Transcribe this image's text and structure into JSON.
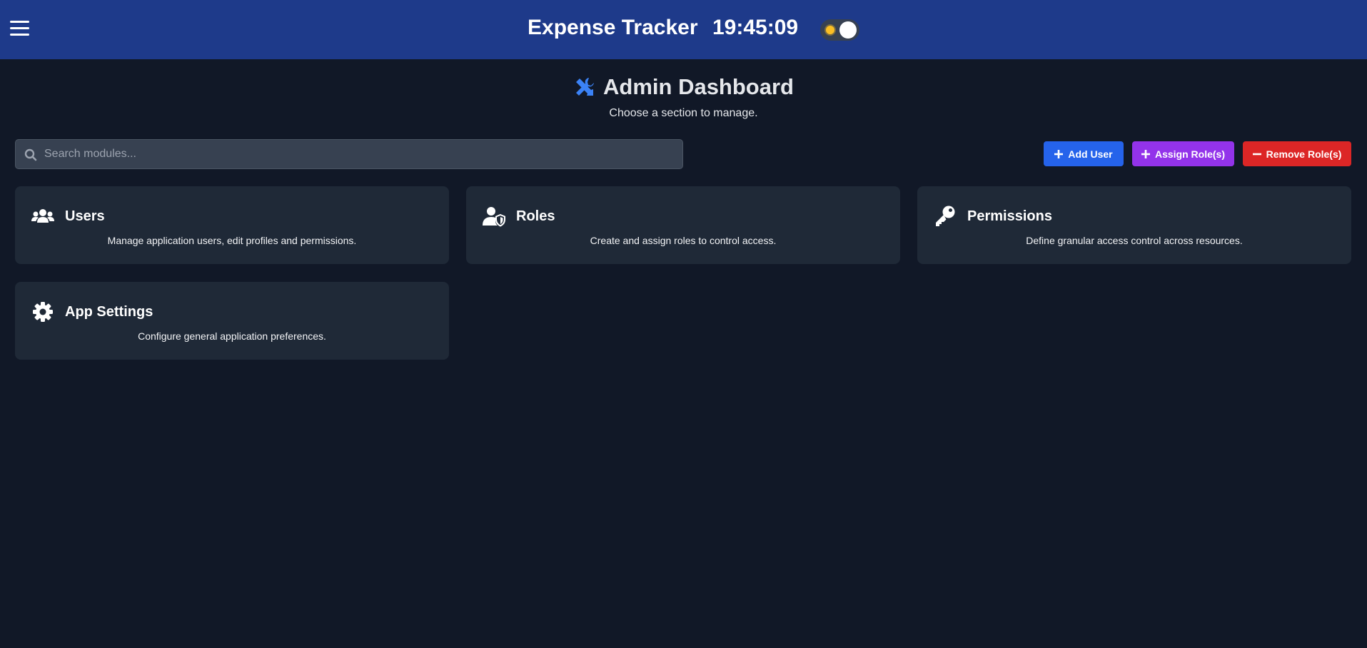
{
  "header": {
    "menu_icon": "hamburger-menu-icon",
    "app_title": "Expense Tracker",
    "clock": "19:45:09",
    "theme_toggle": {
      "icon": "sun-icon",
      "mode": "dark"
    }
  },
  "page": {
    "icon": "tools-icon",
    "title": "Admin Dashboard",
    "subtitle": "Choose a section to manage."
  },
  "search": {
    "icon": "search-icon",
    "placeholder": "Search modules...",
    "value": ""
  },
  "actions": {
    "add_user": {
      "icon": "plus-icon",
      "label": "Add User",
      "color": "#2563eb"
    },
    "assign_roles": {
      "icon": "plus-icon",
      "label": "Assign Role(s)",
      "color": "#9333ea"
    },
    "remove_roles": {
      "icon": "minus-icon",
      "label": "Remove Role(s)",
      "color": "#dc2626"
    }
  },
  "cards": [
    {
      "icon": "users-icon",
      "title": "Users",
      "description": "Manage application users, edit profiles and permissions."
    },
    {
      "icon": "user-shield-icon",
      "title": "Roles",
      "description": "Create and assign roles to control access."
    },
    {
      "icon": "key-icon",
      "title": "Permissions",
      "description": "Define granular access control across resources."
    },
    {
      "icon": "gear-icon",
      "title": "App Settings",
      "description": "Configure general application preferences."
    }
  ],
  "colors": {
    "header_bg": "#1e3a8a",
    "page_bg": "#111827",
    "card_bg": "#1f2937",
    "accent": "#3b82f6"
  }
}
